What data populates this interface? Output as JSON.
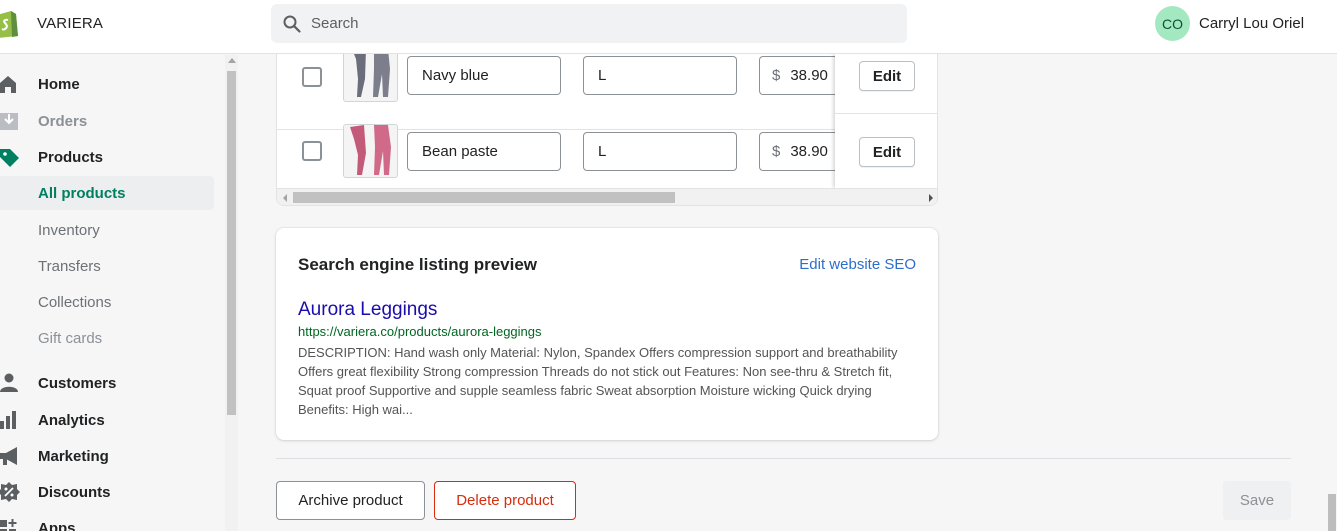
{
  "topbar": {
    "store_name": "VARIERA",
    "search_placeholder": "Search",
    "user_initials": "CO",
    "user_name": "Carryl Lou Oriel"
  },
  "sidebar": {
    "items": [
      {
        "label": "Home",
        "icon": "home-icon"
      },
      {
        "label": "Orders",
        "icon": "orders-icon"
      },
      {
        "label": "Products",
        "icon": "tag-icon"
      },
      {
        "label": "All products"
      },
      {
        "label": "Inventory"
      },
      {
        "label": "Transfers"
      },
      {
        "label": "Collections"
      },
      {
        "label": "Gift cards"
      },
      {
        "label": "Customers",
        "icon": "person-icon"
      },
      {
        "label": "Analytics",
        "icon": "bar-chart-icon"
      },
      {
        "label": "Marketing",
        "icon": "megaphone-icon"
      },
      {
        "label": "Discounts",
        "icon": "discount-icon"
      },
      {
        "label": "Apps",
        "icon": "apps-icon"
      }
    ]
  },
  "variants": {
    "rows": [
      {
        "color": "Navy blue",
        "size": "L",
        "currency": "$",
        "price": "38.90",
        "edit_label": "Edit"
      },
      {
        "color": "Bean paste",
        "size": "L",
        "currency": "$",
        "price": "38.90",
        "edit_label": "Edit"
      }
    ]
  },
  "seo": {
    "heading": "Search engine listing preview",
    "edit_link": "Edit website SEO",
    "page_title": "Aurora Leggings",
    "url": "https://variera.co/products/aurora-leggings",
    "description": "DESCRIPTION: Hand wash only Material: Nylon, Spandex Offers compression support and breathability Offers great flexibility Strong compression Threads do not stick out Features: Non see-thru & Stretch fit, Squat proof Supportive and supple seamless fabric Sweat absorption Moisture wicking Quick drying Benefits: High wai..."
  },
  "actions": {
    "archive_label": "Archive product",
    "delete_label": "Delete product",
    "save_label": "Save"
  },
  "colors": {
    "accent": "#008060",
    "link": "#2c6ecb",
    "critical": "#d72c0d",
    "seo_title": "#1a0dab",
    "seo_url": "#006621"
  }
}
